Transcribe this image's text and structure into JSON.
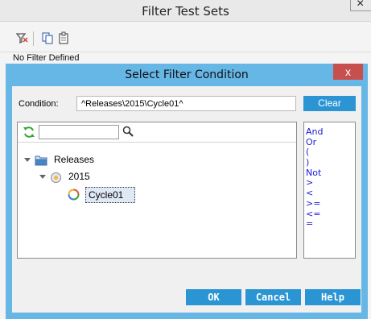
{
  "background_window": {
    "title": "Filter Test Sets",
    "close_symbol": "×",
    "toolbar": [
      {
        "icon": "filter-icon"
      },
      {
        "icon": "copy-icon"
      },
      {
        "icon": "paste-icon"
      }
    ],
    "status_text": "No Filter Defined"
  },
  "dialog": {
    "title": "Select Filter Condition",
    "close_symbol": "x",
    "condition_label": "Condition:",
    "condition_value": "^Releases\\2015\\Cycle01^",
    "clear_label": "Clear",
    "search_value": "",
    "tree": [
      {
        "label": "Releases",
        "icon": "folder-icon",
        "expanded": true
      },
      {
        "label": "2015",
        "icon": "release-icon",
        "expanded": true
      },
      {
        "label": "Cycle01",
        "icon": "cycle-icon",
        "selected": true
      }
    ],
    "operators": [
      "And",
      "Or",
      "(",
      ")",
      "Not",
      ">",
      "<",
      ">=",
      "<=",
      "="
    ],
    "buttons": {
      "ok": "OK",
      "cancel": "Cancel",
      "help": "Help"
    }
  },
  "colors": {
    "dialog_frame": "#66b6e6",
    "button": "#2b95d3",
    "close_button": "#c7504f",
    "operator_text": "#1a1ad6"
  }
}
